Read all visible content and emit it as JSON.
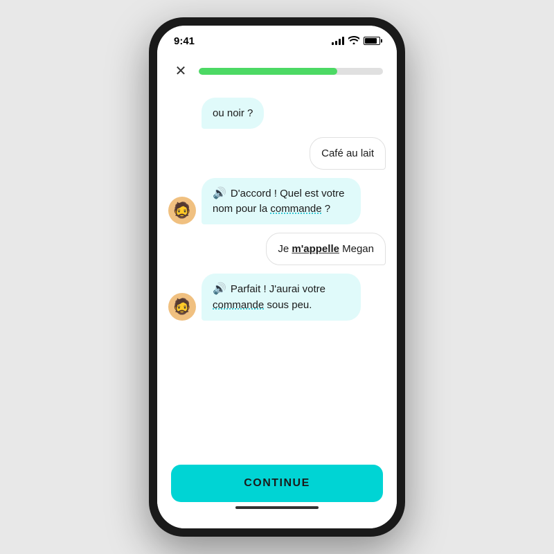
{
  "statusBar": {
    "time": "9:41"
  },
  "header": {
    "closeLabel": "✕",
    "progressPercent": 75
  },
  "chat": {
    "messages": [
      {
        "type": "bot-partial",
        "text": "ou noir ?"
      },
      {
        "type": "user",
        "text": "Café au lait"
      },
      {
        "type": "bot",
        "hasSpeaker": true,
        "text": "D'accord ! Quel est votre nom pour la commande ?"
      },
      {
        "type": "user",
        "text": "Je m'appelle Megan",
        "boldWord": "m'appelle",
        "underlineWord": "m'appelle"
      },
      {
        "type": "bot",
        "hasSpeaker": true,
        "text": "Parfait ! J'aurai votre commande sous peu."
      }
    ]
  },
  "footer": {
    "continueLabel": "CONTINUE"
  },
  "avatar": {
    "emoji": "🧔"
  }
}
